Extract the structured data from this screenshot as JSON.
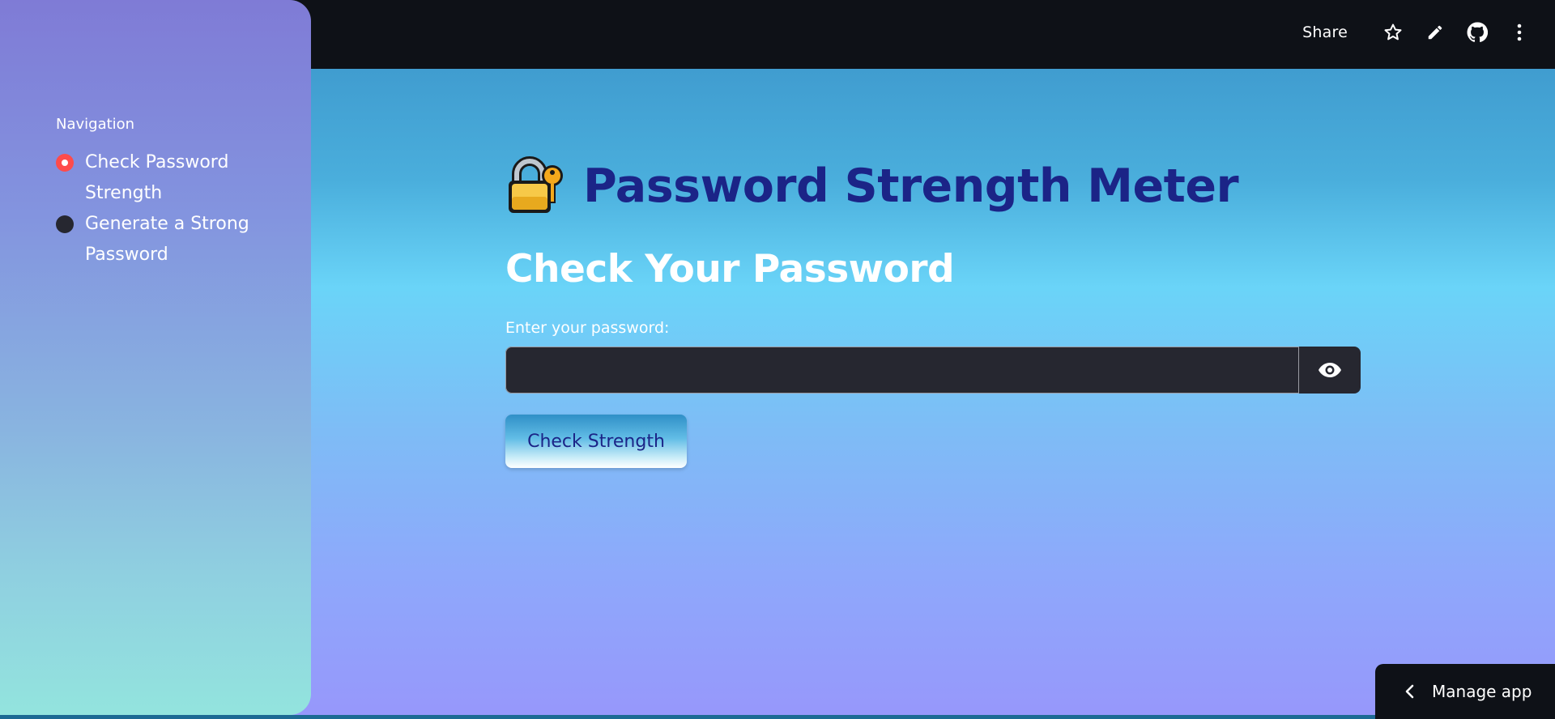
{
  "header": {
    "share_label": "Share",
    "icons": [
      "star-icon",
      "pencil-icon",
      "github-icon",
      "kebab-menu-icon"
    ]
  },
  "sidebar": {
    "nav_title": "Navigation",
    "items": [
      {
        "label": "Check Password Strength",
        "selected": true
      },
      {
        "label": "Generate a Strong Password",
        "selected": false
      }
    ]
  },
  "main": {
    "title_emoji": "lock-with-key-icon",
    "title": "Password Strength Meter",
    "section_title": "Check Your Password",
    "field_label": "Enter your password:",
    "password_value": "",
    "check_button_label": "Check Strength"
  },
  "footer": {
    "manage_app_label": "Manage app"
  },
  "colors": {
    "title": "#1b2487",
    "radio_selected": "#ff4b4b",
    "input_bg": "#262730",
    "header_bg": "#0e1117"
  }
}
